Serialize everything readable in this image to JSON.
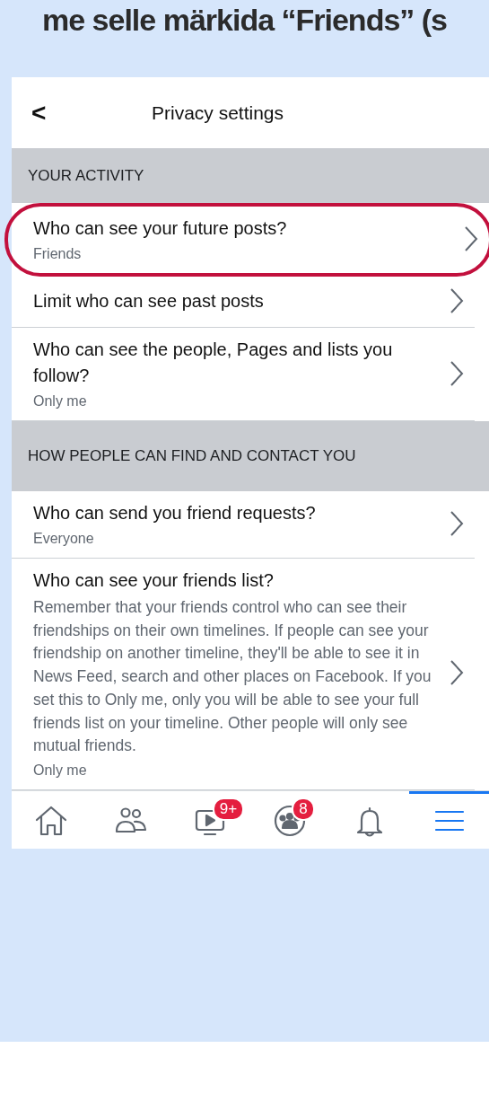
{
  "caption": "me selle märkida “Friends” (s",
  "header": {
    "back": "<",
    "title": "Privacy settings"
  },
  "sections": [
    {
      "title": "YOUR ACTIVITY",
      "items": [
        {
          "title": "Who can see your future posts?",
          "value": "Friends",
          "highlighted": true
        },
        {
          "title": "Limit who can see past posts",
          "highlighted": false
        },
        {
          "title": "Who can see the people, Pages and lists you follow?",
          "value": "Only me",
          "highlighted": false
        }
      ]
    },
    {
      "title": "HOW PEOPLE CAN FIND AND CONTACT YOU",
      "items": [
        {
          "title": "Who can send you friend requests?",
          "value": "Everyone",
          "highlighted": false
        },
        {
          "title": "Who can see your friends list?",
          "description": "Remember that your friends control who can see their friendships on their own timelines. If people can see your friendship on another timeline, they'll be able to see it in News Feed, search and other places on Facebook. If you set this to Only me, only you will be able to see your full friends list on your timeline. Other people will only see mutual friends.",
          "value": "Only me",
          "highlighted": false
        }
      ]
    }
  ],
  "tabs": [
    {
      "kind": "home",
      "selected": false
    },
    {
      "kind": "friends",
      "selected": false
    },
    {
      "kind": "watch",
      "badge": "9+",
      "selected": false
    },
    {
      "kind": "groups",
      "badge": "8",
      "selected": false
    },
    {
      "kind": "bell",
      "selected": false
    },
    {
      "kind": "menu",
      "selected": true
    }
  ]
}
